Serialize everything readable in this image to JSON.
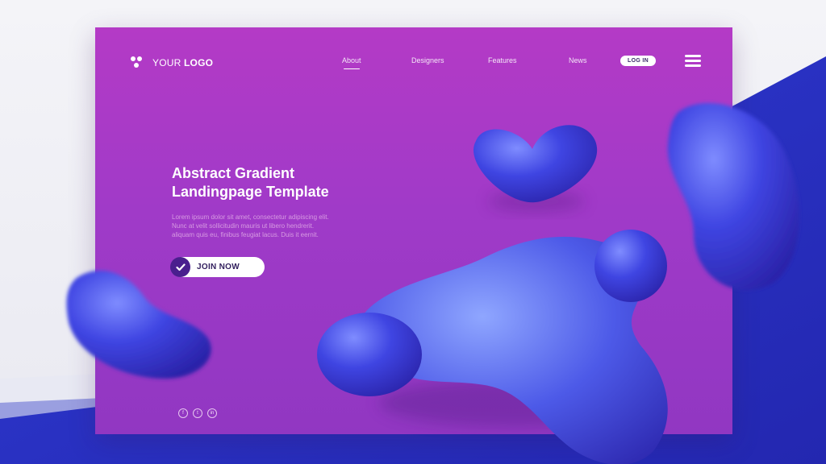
{
  "logo": {
    "text_light": "YOUR",
    "text_bold": "LOGO"
  },
  "nav": {
    "items": [
      {
        "label": "About",
        "active": true
      },
      {
        "label": "Designers",
        "active": false
      },
      {
        "label": "Features",
        "active": false
      },
      {
        "label": "News",
        "active": false
      }
    ],
    "login_label": "LOG IN"
  },
  "hero": {
    "title_line1": "Abstract Gradient",
    "title_line2": "Landingpage Template",
    "body_lines": [
      "Lorem ipsum dolor sit amet, consectetur adipiscing elit.",
      "Nunc at velit sollicitudin mauris ut libero hendrerit.",
      "aliquam quis eu, finibus feugiat lacus. Duis it eernit."
    ],
    "cta_label": "JOIN NOW"
  },
  "socials": [
    {
      "icon": "facebook-icon",
      "glyph": "f"
    },
    {
      "icon": "twitter-icon",
      "glyph": "t"
    },
    {
      "icon": "linkedin-icon",
      "glyph": "in"
    }
  ],
  "colors": {
    "card_top": "#b43ac6",
    "card_bottom": "#9137c2",
    "blob_blue": "#3f3de0",
    "band_blue": "#2b34c9"
  }
}
